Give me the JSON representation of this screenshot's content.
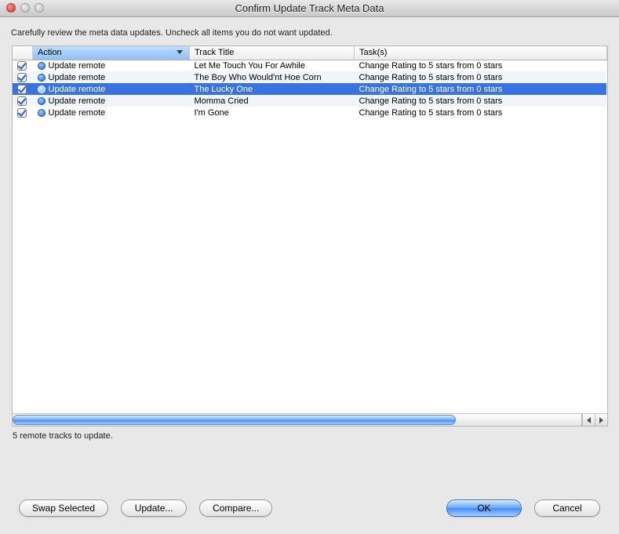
{
  "window": {
    "title": "Confirm Update Track Meta Data"
  },
  "instructions": "Carefully review the meta data updates. Uncheck all items you do not want updated.",
  "columns": {
    "checkbox": "",
    "action": "Action",
    "title": "Track Title",
    "task": "Task(s)"
  },
  "rows": [
    {
      "checked": true,
      "selected": false,
      "action": "Update remote",
      "title": "Let Me Touch You For Awhile",
      "task": "Change Rating to 5 stars from 0 stars"
    },
    {
      "checked": true,
      "selected": false,
      "action": "Update remote",
      "title": "The Boy Who Would'nt Hoe Corn",
      "task": "Change Rating to 5 stars from 0 stars"
    },
    {
      "checked": true,
      "selected": true,
      "action": "Update remote",
      "title": "The Lucky One",
      "task": "Change Rating to 5 stars from 0 stars"
    },
    {
      "checked": true,
      "selected": false,
      "action": "Update remote",
      "title": "Momma Cried",
      "task": "Change Rating to 5 stars from 0 stars"
    },
    {
      "checked": true,
      "selected": false,
      "action": "Update remote",
      "title": "I'm Gone",
      "task": "Change Rating to 5 stars from 0 stars"
    }
  ],
  "status": "5 remote tracks to update.",
  "buttons": {
    "swap": "Swap Selected",
    "update": "Update...",
    "compare": "Compare...",
    "ok": "OK",
    "cancel": "Cancel"
  }
}
